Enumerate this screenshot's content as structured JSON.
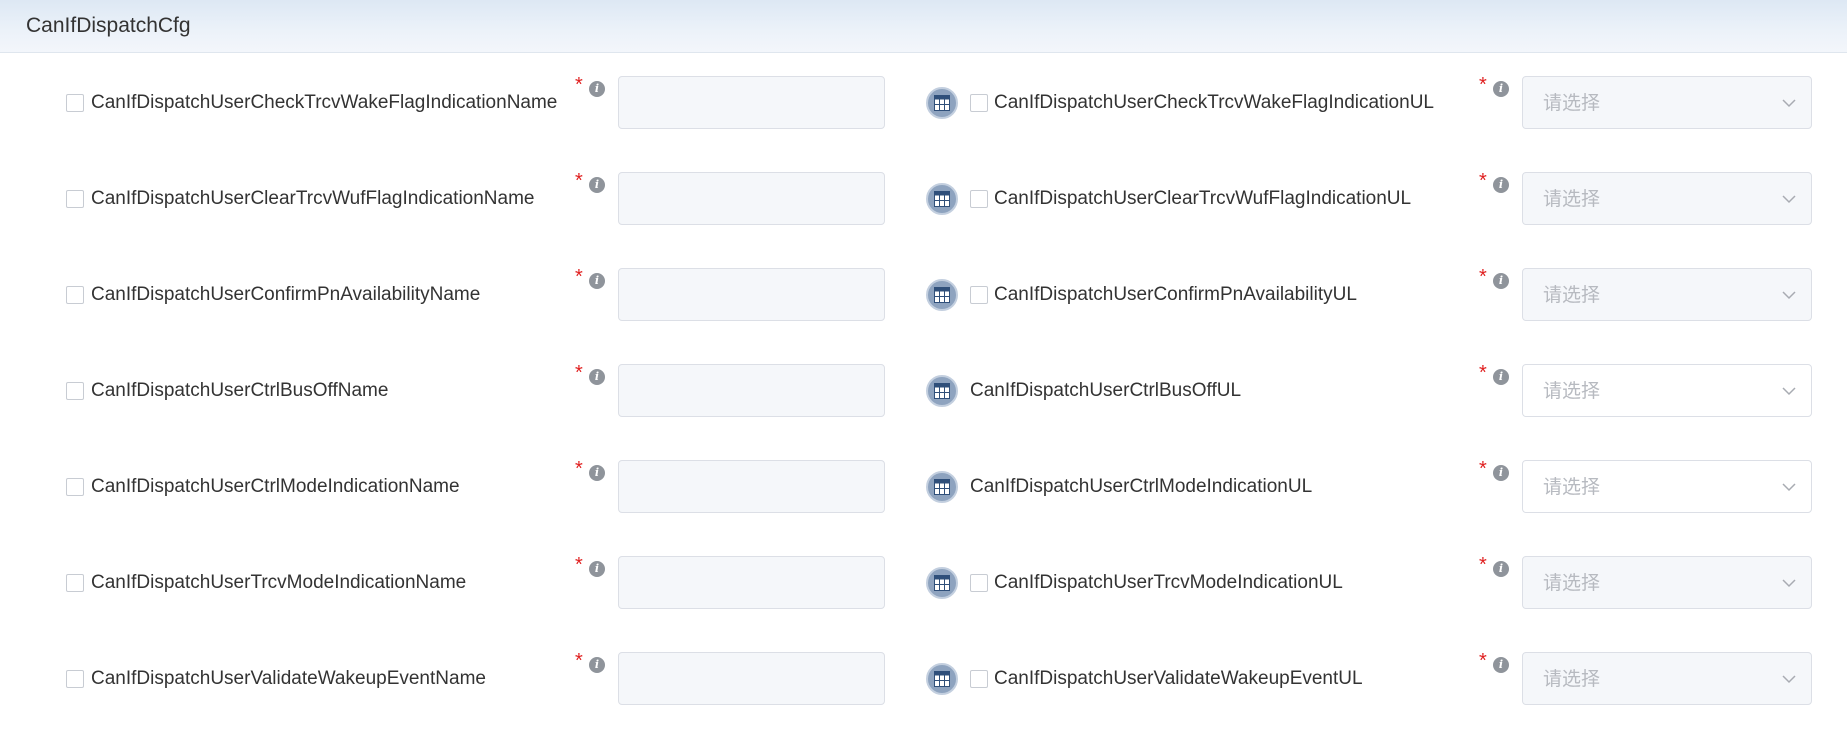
{
  "header": {
    "title": "CanIfDispatchCfg"
  },
  "select_placeholder": "请选择",
  "colors": {
    "required": "#e02020",
    "header_bg": "#e6eef7",
    "input_disabled_bg": "#f5f7fa",
    "table_icon_bg": "#8ea3bf"
  },
  "rows": [
    {
      "left_label": "CanIfDispatchUserCheckTrcvWakeFlagIndicationName",
      "left_value": "",
      "right_label": "CanIfDispatchUserCheckTrcvWakeFlagIndicationUL",
      "right_has_checkbox": true,
      "right_select_enabled": false
    },
    {
      "left_label": "CanIfDispatchUserClearTrcvWufFlagIndicationName",
      "left_value": "",
      "right_label": "CanIfDispatchUserClearTrcvWufFlagIndicationUL",
      "right_has_checkbox": true,
      "right_select_enabled": false
    },
    {
      "left_label": "CanIfDispatchUserConfirmPnAvailabilityName",
      "left_value": "",
      "right_label": "CanIfDispatchUserConfirmPnAvailabilityUL",
      "right_has_checkbox": true,
      "right_select_enabled": false
    },
    {
      "left_label": "CanIfDispatchUserCtrlBusOffName",
      "left_value": "",
      "right_label": "CanIfDispatchUserCtrlBusOffUL",
      "right_has_checkbox": false,
      "right_select_enabled": true
    },
    {
      "left_label": "CanIfDispatchUserCtrlModeIndicationName",
      "left_value": "",
      "right_label": "CanIfDispatchUserCtrlModeIndicationUL",
      "right_has_checkbox": false,
      "right_select_enabled": true
    },
    {
      "left_label": "CanIfDispatchUserTrcvModeIndicationName",
      "left_value": "",
      "right_label": "CanIfDispatchUserTrcvModeIndicationUL",
      "right_has_checkbox": true,
      "right_select_enabled": false
    },
    {
      "left_label": "CanIfDispatchUserValidateWakeupEventName",
      "left_value": "",
      "right_label": "CanIfDispatchUserValidateWakeupEventUL",
      "right_has_checkbox": true,
      "right_select_enabled": false
    }
  ]
}
